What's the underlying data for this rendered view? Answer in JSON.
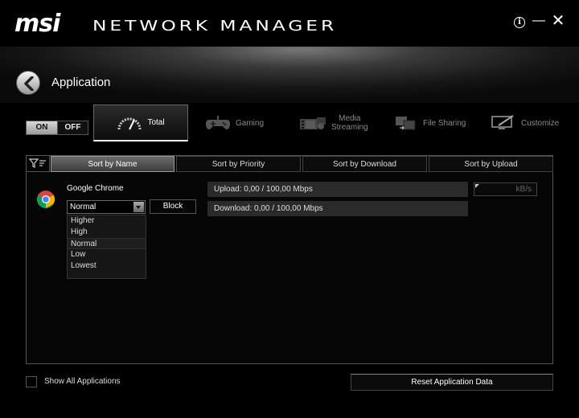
{
  "window": {
    "logo": "msi",
    "app_name": "NETWORK MANAGER",
    "buttons": {
      "info": "i",
      "minimize": "—",
      "close": "✕"
    }
  },
  "header": {
    "title": "Application"
  },
  "toggle": {
    "on_label": "ON",
    "off_label": "OFF",
    "state": "on"
  },
  "categories": [
    {
      "label": "Total",
      "icon": "speedometer-icon",
      "active": true
    },
    {
      "label": "Gaming",
      "icon": "gamepad-icon"
    },
    {
      "label": "Media Streaming",
      "line1": "Media",
      "line2": "Streaming",
      "icon": "film-icon"
    },
    {
      "label": "File Sharing",
      "icon": "file-share-icon"
    },
    {
      "label": "Customize",
      "icon": "monitor-edit-icon"
    }
  ],
  "sort_tabs": [
    {
      "label": "Sort by Name",
      "active": true
    },
    {
      "label": "Sort by Priority"
    },
    {
      "label": "Sort by Download"
    },
    {
      "label": "Sort by Upload"
    }
  ],
  "app_row": {
    "name": "Google Chrome",
    "icon": "chrome-icon",
    "priority": "Normal",
    "block_label": "Block",
    "upload": "Upload: 0,00 / 100,00 Mbps",
    "download": "Download: 0,00 / 100,00 Mbps",
    "rate_unit": "kB/s"
  },
  "priority_options": [
    "Higher",
    "High",
    "Normal",
    "Low",
    "Lowest"
  ],
  "bottom": {
    "show_all_label": "Show All Applications",
    "reset_label": "Reset Application Data"
  },
  "colors": {
    "background": "#000000",
    "text": "#dddddd",
    "inactive_tab": "#8a8a8a",
    "bar": "#2a2a2a"
  }
}
